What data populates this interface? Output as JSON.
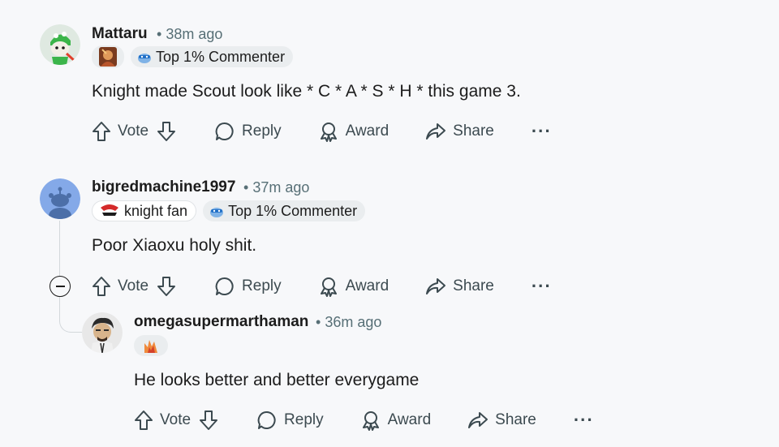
{
  "comments": [
    {
      "username": "Mattaru",
      "time": "38m ago",
      "flairs": {
        "rank": "Top 1% Commenter"
      },
      "body": "Knight made Scout look like * C * A * S * H * this game 3.",
      "actions": {
        "vote": "Vote",
        "reply": "Reply",
        "award": "Award",
        "share": "Share",
        "more": "···"
      }
    },
    {
      "username": "bigredmachine1997",
      "time": "37m ago",
      "flairs": {
        "team": "knight fan",
        "rank": "Top 1% Commenter"
      },
      "body": "Poor Xiaoxu holy shit.",
      "actions": {
        "vote": "Vote",
        "reply": "Reply",
        "award": "Award",
        "share": "Share",
        "more": "···"
      }
    },
    {
      "username": "omegasupermarthaman",
      "time": "36m ago",
      "flairs": {},
      "body": "He looks better and better everygame",
      "actions": {
        "vote": "Vote",
        "reply": "Reply",
        "award": "Award",
        "share": "Share",
        "more": "···"
      }
    }
  ],
  "separator": "•",
  "colors": {
    "text": "#1c1c1c",
    "meta": "#576f76",
    "flair_bg": "#eaedef",
    "background": "#f7f8fa"
  }
}
